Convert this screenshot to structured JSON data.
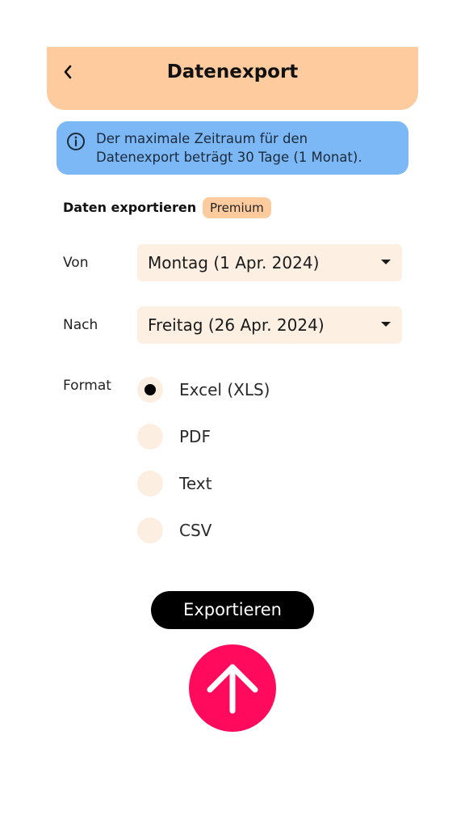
{
  "header": {
    "title": "Datenexport"
  },
  "info": {
    "line1": "Der maximale Zeitraum für den",
    "line2": "Datenexport beträgt 30 Tage (1 Monat)."
  },
  "export_section": {
    "title": "Daten exportieren",
    "badge": "Premium"
  },
  "from": {
    "label": "Von",
    "value": "Montag (1 Apr. 2024)"
  },
  "to": {
    "label": "Nach",
    "value": "Freitag (26 Apr. 2024)"
  },
  "format": {
    "label": "Format",
    "selected": "Excel (XLS)",
    "options": [
      {
        "label": "Excel (XLS)",
        "selected": true
      },
      {
        "label": "PDF",
        "selected": false
      },
      {
        "label": "Text",
        "selected": false
      },
      {
        "label": "CSV",
        "selected": false
      }
    ]
  },
  "actions": {
    "export_label": "Exportieren"
  },
  "colors": {
    "header_bg": "#fdcb9e",
    "info_bg": "#7bb8f5",
    "select_bg": "#fdf0e3",
    "fab": "#ff0a5c",
    "button": "#000000"
  },
  "icons": {
    "back": "chevron-left-icon",
    "info": "info-icon",
    "dropdown": "caret-down-icon",
    "upload": "arrow-up-icon"
  }
}
